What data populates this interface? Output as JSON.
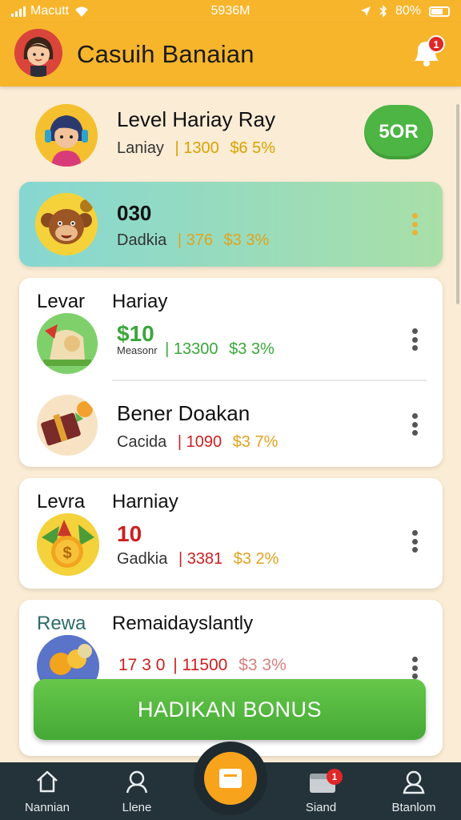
{
  "status_bar": {
    "carrier": "Macutt",
    "time": "5936M",
    "battery": "80%"
  },
  "header": {
    "title": "Casuih Banaian",
    "notification_count": "1"
  },
  "top_card": {
    "name": "Level Hariay Ray",
    "sub_label": "Laniay",
    "points": "| 1300",
    "amount": "$6 5%",
    "action": "5OR"
  },
  "highlight_card": {
    "name": "030",
    "sub_label": "Dadkia",
    "points": "| 376",
    "amount": "$3 3%"
  },
  "group_1": {
    "section_label": "Levar",
    "header_name": "Hariay",
    "row_1": {
      "title": "$10",
      "sub_label": "Measonr",
      "points": "| 13300",
      "amount": "$3 3%"
    },
    "row_2": {
      "name": "Bener Doakan",
      "sub_label": "Cacida",
      "points": "| 1090",
      "amount": "$3 7%"
    }
  },
  "group_2": {
    "section_label": "Levra",
    "header_name": "Harniay",
    "row_1": {
      "title": "10",
      "sub_label": "Gadkia",
      "points": "| 3381",
      "amount": "$3 2%"
    }
  },
  "group_3": {
    "section_label": "Rewa",
    "header_name": "Remaidayslantly",
    "row_1": {
      "title": "17 3 0",
      "points": "| 11500",
      "amount": "$3 3%"
    }
  },
  "bonus_button": "HADIKAN BONUS",
  "bottom_nav": {
    "items": [
      {
        "label": "Nannian",
        "icon": "home-icon"
      },
      {
        "label": "Llene",
        "icon": "user-icon"
      },
      {
        "label": "Siand",
        "icon": "inbox-icon",
        "badge": "1"
      },
      {
        "label": "Btanlom",
        "icon": "profile-icon"
      }
    ]
  },
  "colors": {
    "brand": "#f7b52c",
    "green": "#4cb543",
    "gold_text": "#d9a300",
    "red_text": "#cc1f1f",
    "green_text": "#3aa63a",
    "highlight_bg": "#8fd9cc",
    "nav_bg": "#243239"
  }
}
